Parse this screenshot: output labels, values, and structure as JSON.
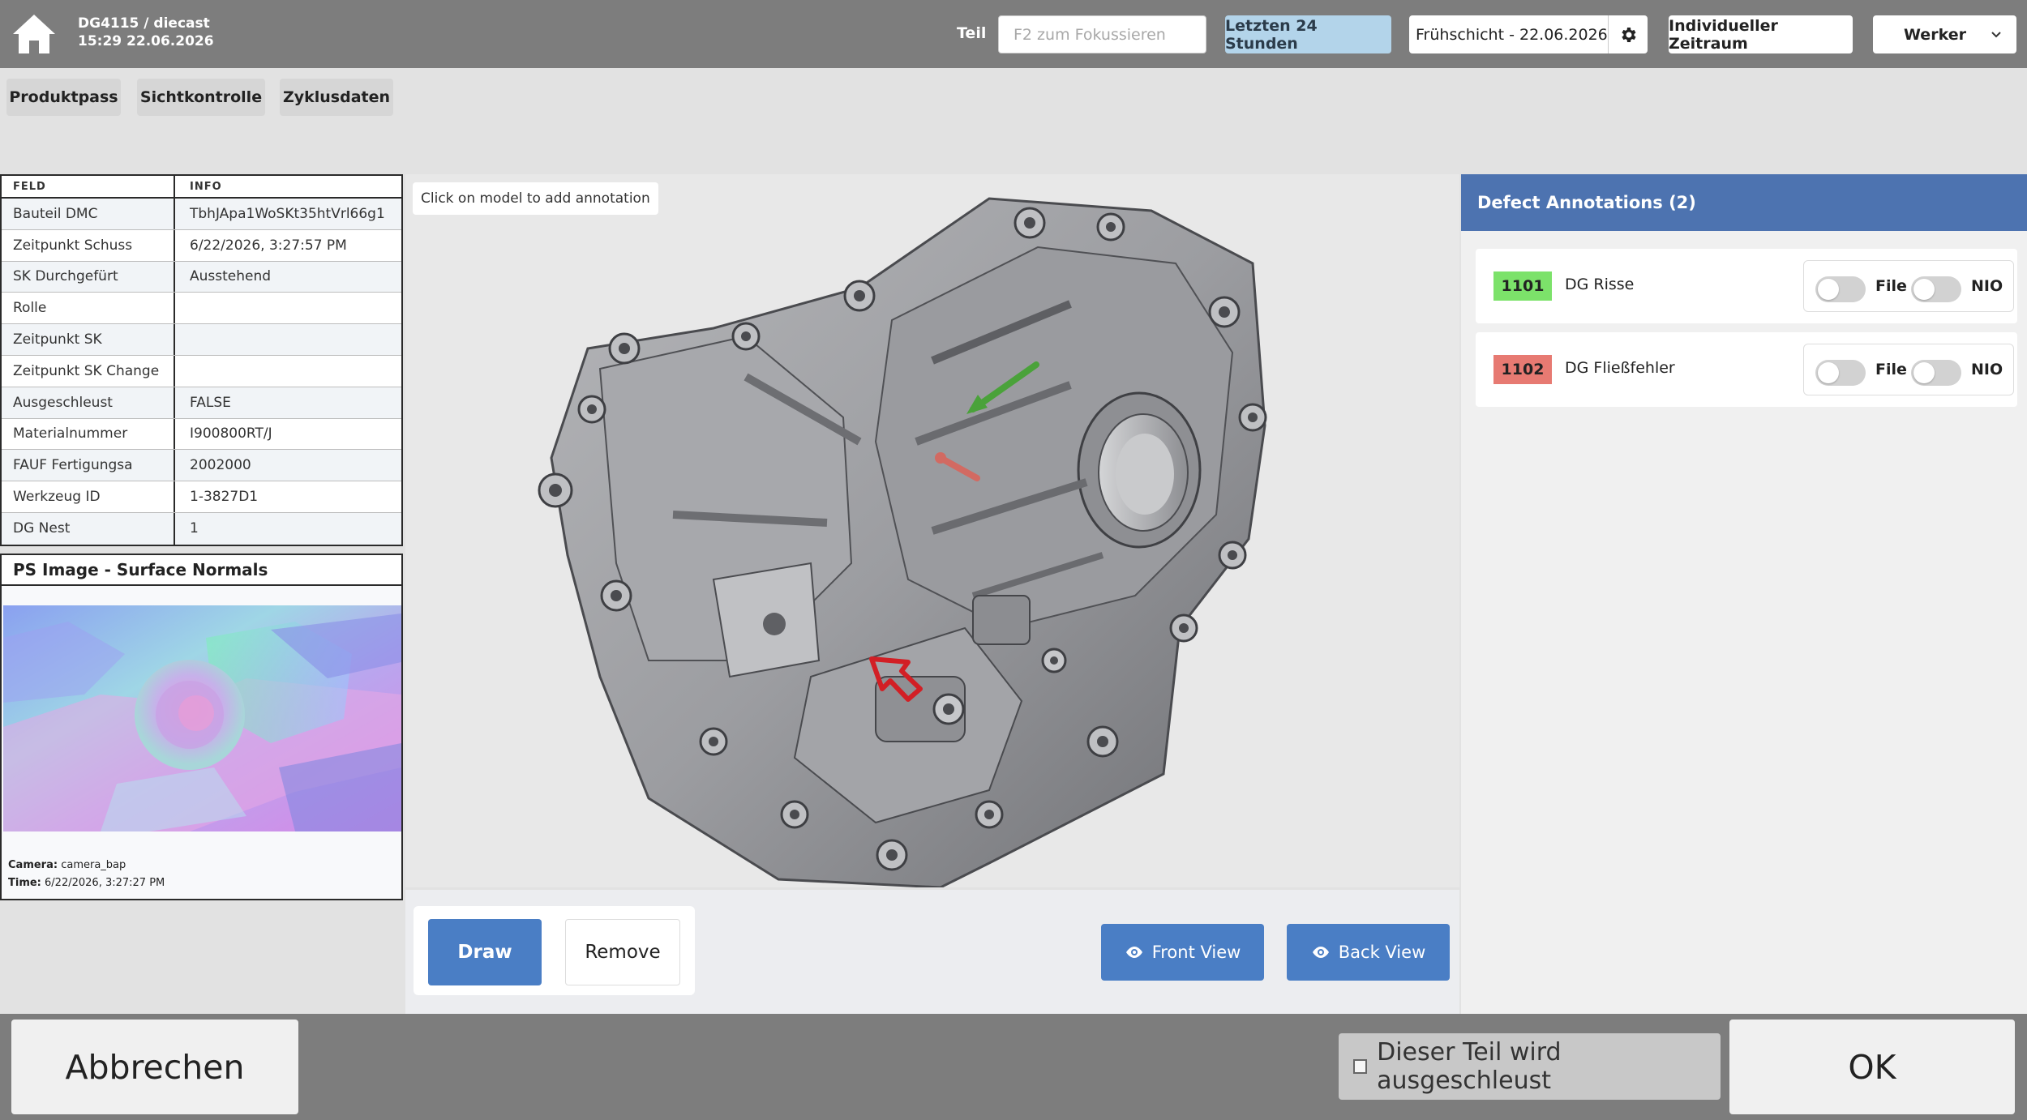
{
  "header": {
    "title_line1": "DG4115 / diecast",
    "title_line2": "15:29 22.06.2026",
    "teil_label": "Teil",
    "search_placeholder": "F2 zum Fokussieren",
    "period_button": "Letzten 24 Stunden",
    "shift_label": "Frühschicht - 22.06.2026",
    "custom_range_button": "Individueller Zeitraum",
    "role_select": "Werker"
  },
  "tabs": [
    "Produktpass",
    "Sichtkontrolle",
    "Zyklusdaten"
  ],
  "info_table": {
    "headers": [
      "FELD",
      "INFO"
    ],
    "rows": [
      [
        "Bauteil DMC",
        "TbhJApa1WoSKt35htVrl66g1"
      ],
      [
        "Zeitpunkt Schuss",
        "6/22/2026, 3:27:57 PM"
      ],
      [
        "SK Durchgefürt",
        "Ausstehend"
      ],
      [
        "Rolle",
        ""
      ],
      [
        "Zeitpunkt SK",
        ""
      ],
      [
        "Zeitpunkt SK Change",
        ""
      ],
      [
        "Ausgeschleust",
        "FALSE"
      ],
      [
        "Materialnummer",
        "I900800RT/J"
      ],
      [
        "FAUF Fertigungsa",
        "2002000"
      ],
      [
        "Werkzeug ID",
        "1-3827D1"
      ],
      [
        "DG Nest",
        "1"
      ]
    ]
  },
  "ps_panel": {
    "title": "PS Image - Surface Normals",
    "camera_label": "Camera:",
    "camera_value": "camera_bap",
    "time_label": "Time:",
    "time_value": "6/22/2026, 3:27:27 PM"
  },
  "viewer": {
    "hint": "Click on model to add annotation"
  },
  "tools": {
    "draw": "Draw",
    "remove": "Remove",
    "front_view": "Front View",
    "back_view": "Back View"
  },
  "defects": {
    "header": "Defect Annotations (2)",
    "items": [
      {
        "code": "1101",
        "name": "DG Risse",
        "color": "#7ce26a",
        "toggle1": "File",
        "toggle2": "NIO"
      },
      {
        "code": "1102",
        "name": "DG Fließfehler",
        "color": "#e77a72",
        "toggle1": "File",
        "toggle2": "NIO"
      }
    ]
  },
  "footer": {
    "cancel": "Abbrechen",
    "exclude_label": "Dieser Teil wird ausgeschleust",
    "ok": "OK"
  },
  "colors": {
    "header_bg": "#7d7d7d",
    "accent_blue": "#4a7ec5",
    "panel_header": "#4d73b0",
    "period_button": "#b3d4ea"
  },
  "icons": [
    "home-icon",
    "gear-icon",
    "chevron-down-icon",
    "eye-icon",
    "checkbox-icon"
  ]
}
